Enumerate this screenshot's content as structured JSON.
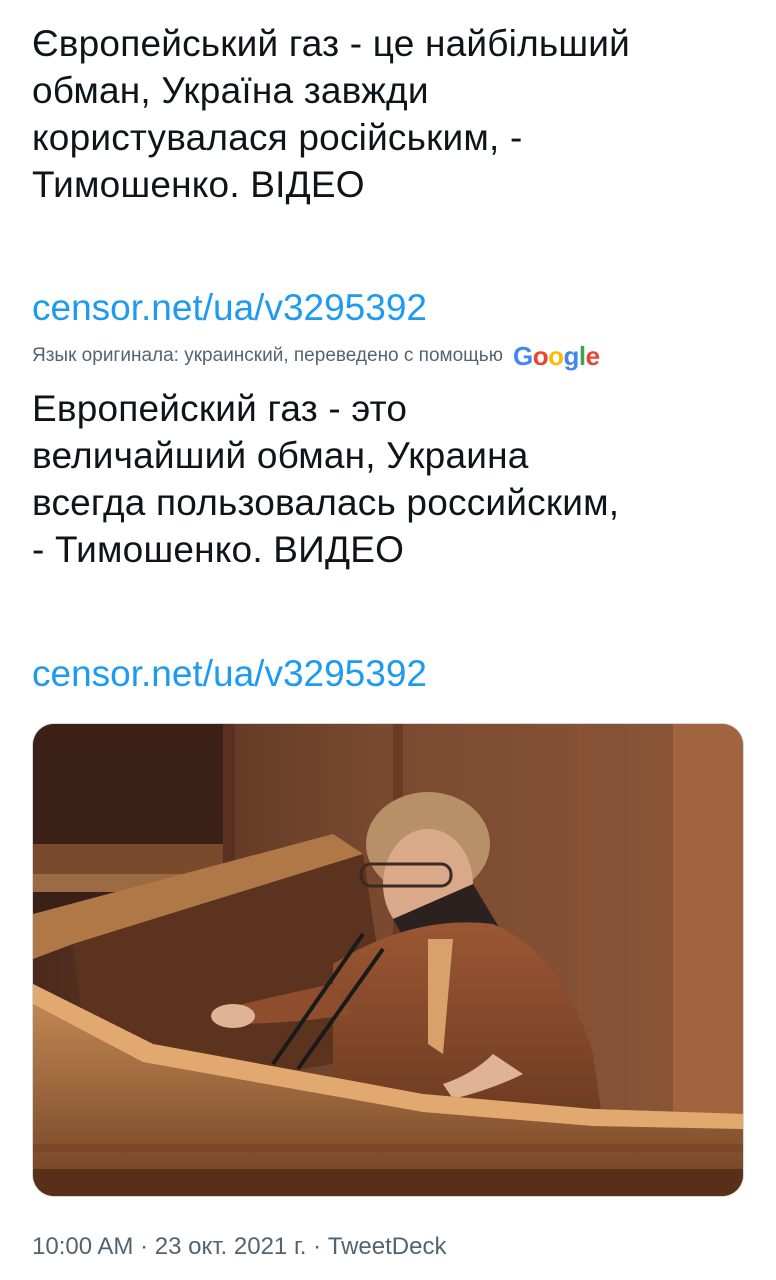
{
  "tweet": {
    "original_text": "Європейський газ - це найбільший\nобман, Україна завжди\nкористувалася російським, -\nТимошенко. ВІДЕО",
    "original_link": "censor.net/ua/v3295392",
    "translation_note": "Язык оригинала: украинский, переведено с помощью",
    "translation_provider": "Google",
    "translated_text": "Европейский газ - это\nвеличайший обман, Украина\nвсегда пользовалась российским,\n- Тимошенко. ВИДЕО",
    "translated_link": "censor.net/ua/v3295392",
    "time": "10:00 AM",
    "date": "23 окт. 2021 г.",
    "source": "TweetDeck",
    "separator": " · "
  },
  "colors": {
    "link": "#1d9bf0",
    "secondary_text": "#536471",
    "primary_text": "#0f1419"
  },
  "media": {
    "icon": "photo-speaker-at-podium"
  }
}
